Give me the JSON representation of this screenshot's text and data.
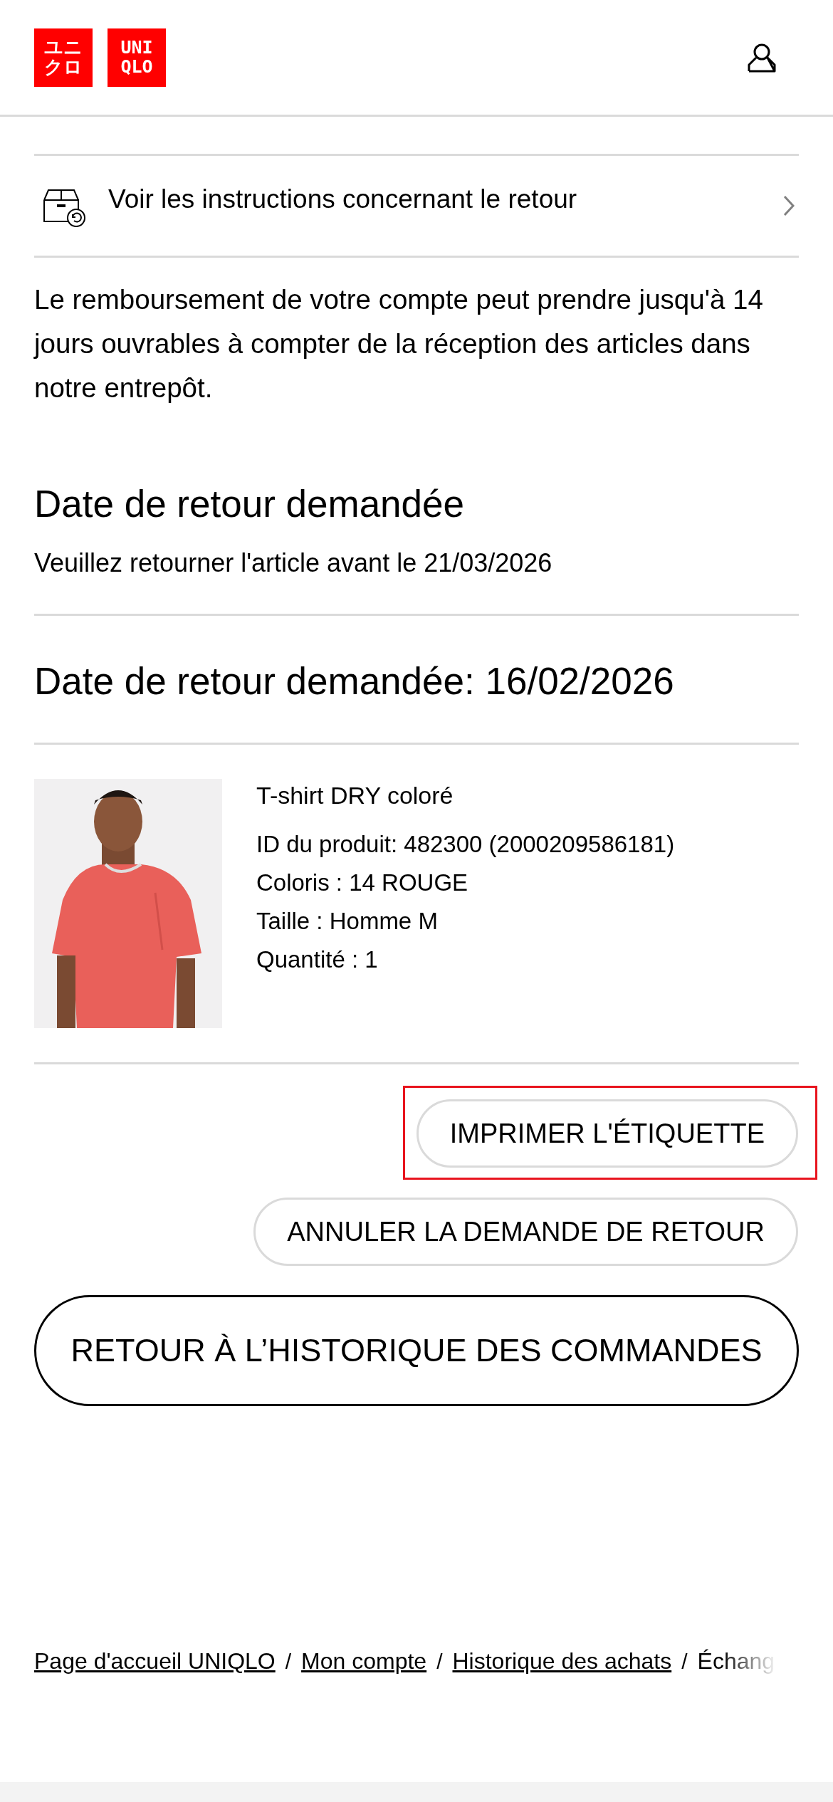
{
  "header": {
    "logo_katakana": [
      "ユニ",
      "クロ"
    ],
    "logo_latin": [
      "UNI",
      "QLO"
    ]
  },
  "instructions_link": {
    "label": "Voir les instructions concernant le retour"
  },
  "refund_note": "Le remboursement de votre compte peut prendre jusqu'à 14 jours ouvrables à compter de la réception des articles dans notre entrepôt.",
  "return_deadline": {
    "heading": "Date de retour demandée",
    "text": "Veuillez retourner l'article avant le 21/03/2026"
  },
  "requested_date": "Date de retour demandée: 16/02/2026",
  "product": {
    "name": "T-shirt DRY coloré",
    "details": [
      "ID du produit: 482300 (2000209586181)",
      "Coloris : 14 ROUGE",
      "Taille : Homme M",
      "Quantité : 1"
    ]
  },
  "actions": [
    {
      "label": "IMPRIMER L'ÉTIQUETTE",
      "highlighted": true
    },
    {
      "label": "ANNULER LA DEMANDE DE RETOUR",
      "highlighted": false
    }
  ],
  "back_button": "RETOUR À L’HISTORIQUE DES COMMANDES",
  "breadcrumb": [
    {
      "label": "Page d'accueil UNIQLO",
      "link": true
    },
    {
      "separator": "/",
      "label": "Mon compte",
      "link": true
    },
    {
      "separator": "/",
      "label": "Historique des achats",
      "link": true
    },
    {
      "separator": "/",
      "label": "Échang",
      "link": false
    }
  ]
}
